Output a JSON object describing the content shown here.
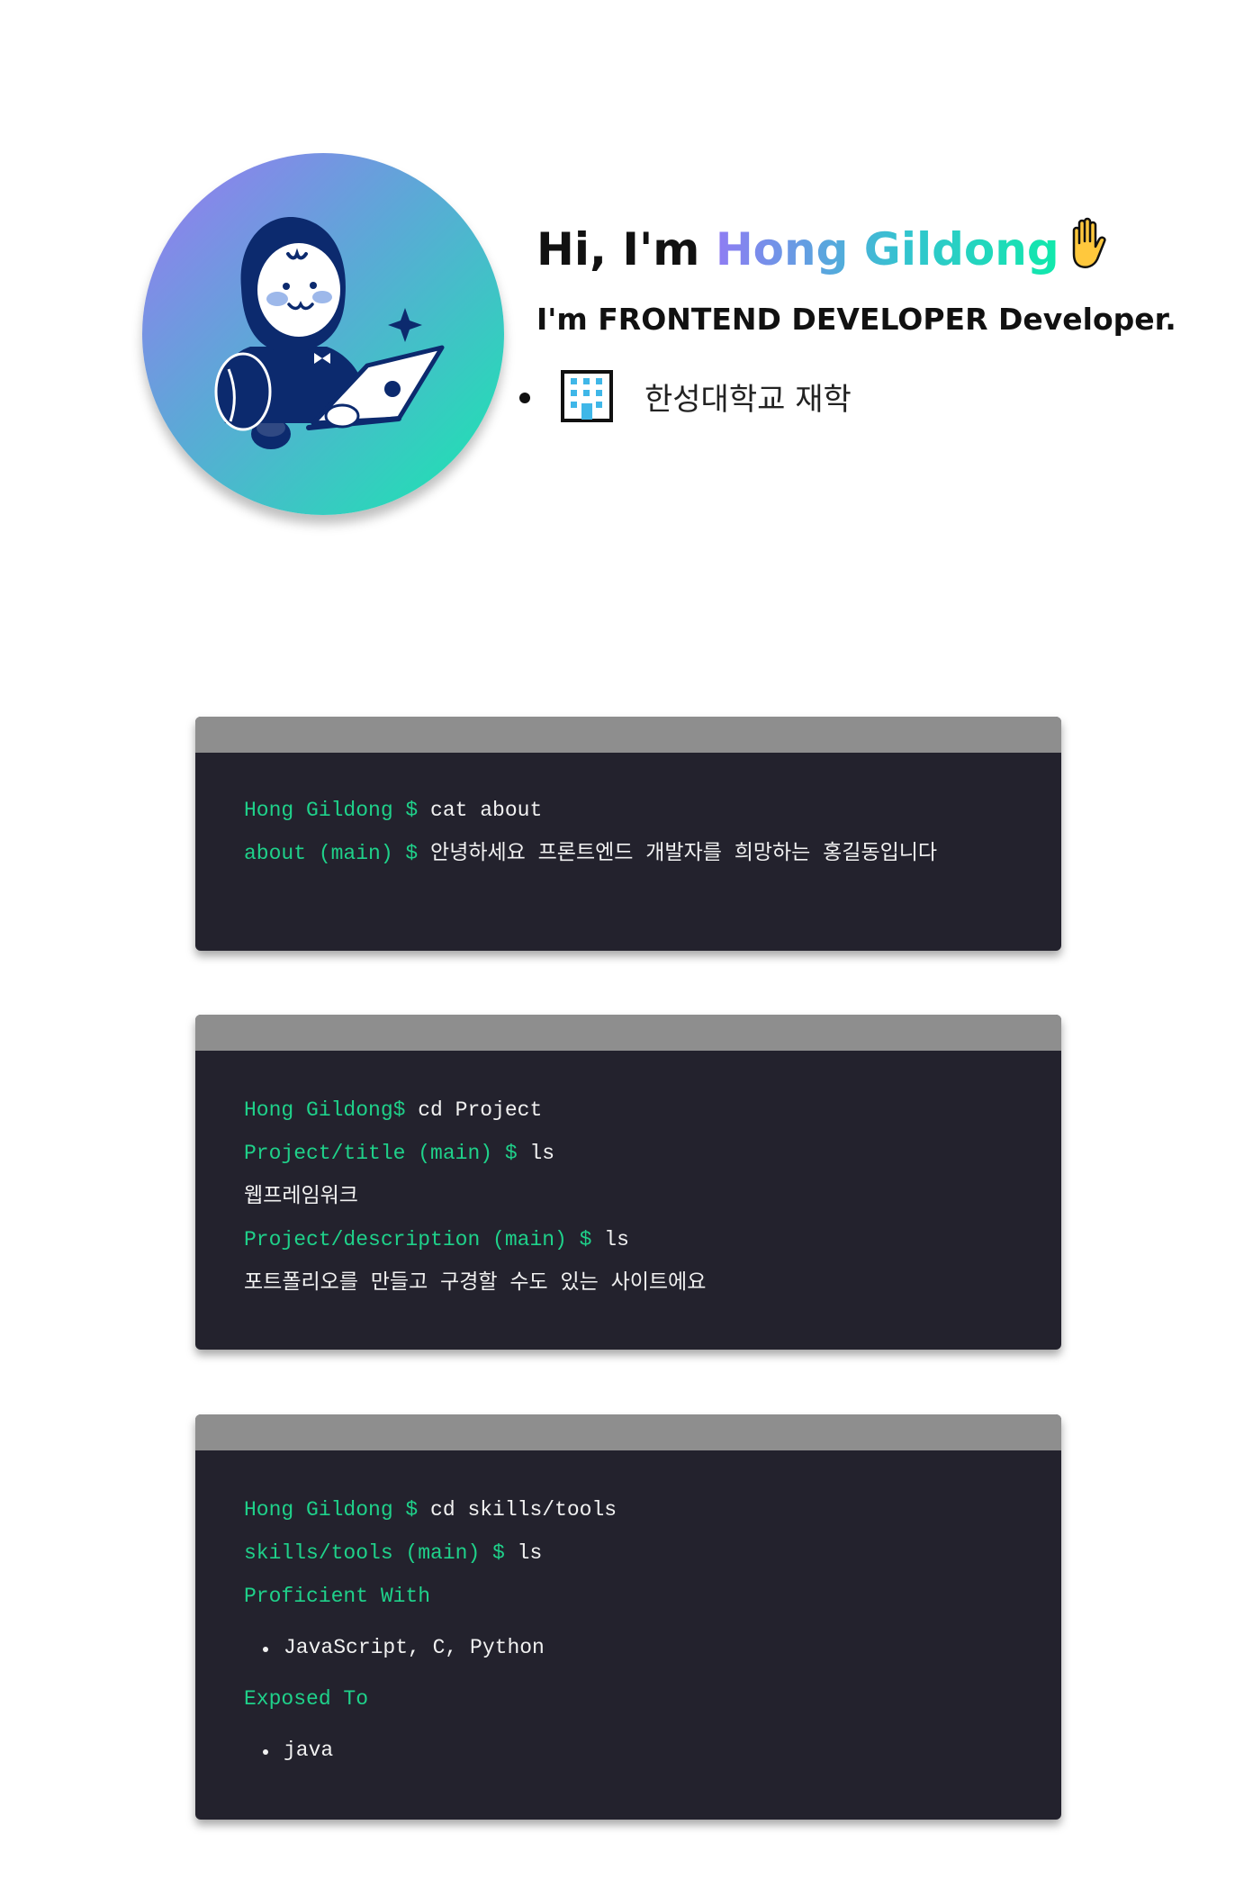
{
  "header": {
    "greeting": "Hi, I'm ",
    "name": "Hong Gildong",
    "subtitle": "I'm FRONTEND DEVELOPER Developer.",
    "facts": [
      {
        "icon": "building-icon",
        "text": "한성대학교 재학"
      }
    ],
    "gradient_colors": [
      "#8f7cf3",
      "#33c4cf",
      "#10e9ab"
    ]
  },
  "terminals": {
    "about": {
      "lines": [
        {
          "prompt": "Hong Gildong $ ",
          "text": "cat about"
        },
        {
          "prompt": "about (main) $ ",
          "text": "안녕하세요 프론트엔드 개발자를 희망하는 홍길동입니다"
        }
      ]
    },
    "project": {
      "lines": [
        {
          "prompt": "Hong Gildong$ ",
          "text": "cd Project"
        },
        {
          "prompt": "Project/title (main) $ ",
          "text": "ls"
        },
        {
          "text": "웹프레임워크"
        },
        {
          "prompt": "Project/description (main) $ ",
          "text": "ls"
        },
        {
          "text": "포트폴리오를 만들고 구경할 수도 있는 사이트에요"
        }
      ]
    },
    "skills": {
      "lines": [
        {
          "prompt": "Hong Gildong $ ",
          "text": "cd skills/tools"
        },
        {
          "prompt": "skills/tools (main) $ ",
          "text": "ls"
        }
      ],
      "proficient_heading": "Proficient With",
      "proficient_items": [
        "JavaScript, C, Python"
      ],
      "exposed_heading": "Exposed To",
      "exposed_items": [
        "java"
      ]
    }
  },
  "colors": {
    "terminal_bg": "#23222d",
    "terminal_bar": "#8e8e8e",
    "prompt_green": "#1fd18a"
  }
}
